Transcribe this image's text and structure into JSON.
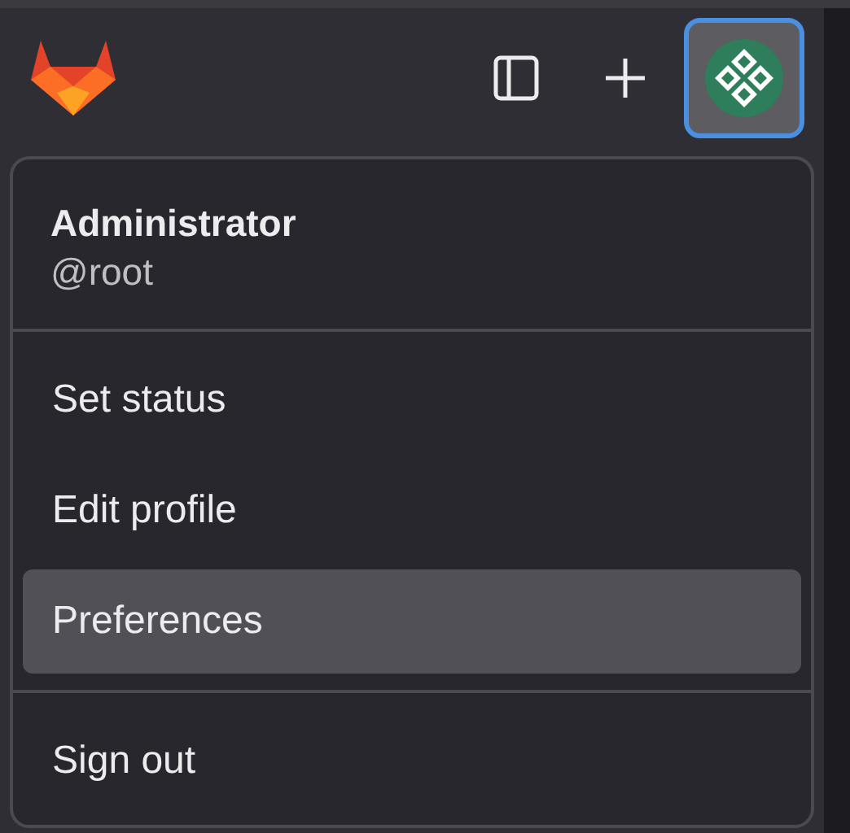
{
  "user": {
    "name": "Administrator",
    "handle": "@root"
  },
  "menu_sections": [
    {
      "items": [
        {
          "label": "Set status",
          "selected": false
        },
        {
          "label": "Edit profile",
          "selected": false
        },
        {
          "label": "Preferences",
          "selected": true
        }
      ]
    },
    {
      "items": [
        {
          "label": "Sign out",
          "selected": false
        }
      ]
    }
  ]
}
